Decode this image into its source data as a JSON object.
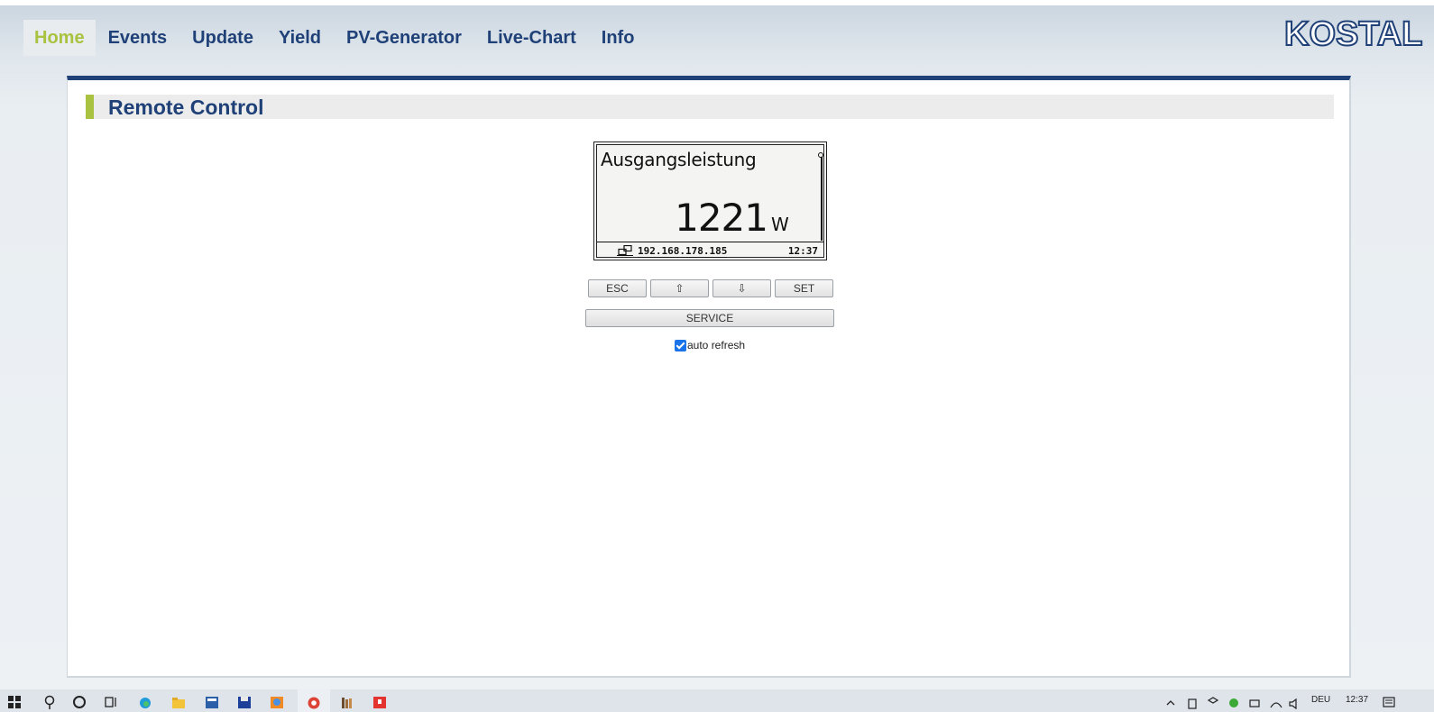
{
  "nav": {
    "items": [
      {
        "label": "Home",
        "active": true
      },
      {
        "label": "Events"
      },
      {
        "label": "Update"
      },
      {
        "label": "Yield"
      },
      {
        "label": "PV-Generator"
      },
      {
        "label": "Live-Chart"
      },
      {
        "label": "Info"
      }
    ]
  },
  "logo": "KOSTAL",
  "section": {
    "title": "Remote Control"
  },
  "lcd": {
    "label": "Ausgangsleistung",
    "value": "1221",
    "unit": "W",
    "ip": "192.168.178.185",
    "time": "12:37"
  },
  "controls": {
    "esc": "ESC",
    "up": "⇧",
    "down": "⇩",
    "set": "SET",
    "service": "SERVICE",
    "auto_refresh_label": "auto refresh",
    "auto_refresh_checked": true
  },
  "taskbar": {
    "language": "DEU",
    "clock": "12:37"
  },
  "colors": {
    "brand_blue": "#1f4178",
    "accent_green": "#a9c23f"
  }
}
